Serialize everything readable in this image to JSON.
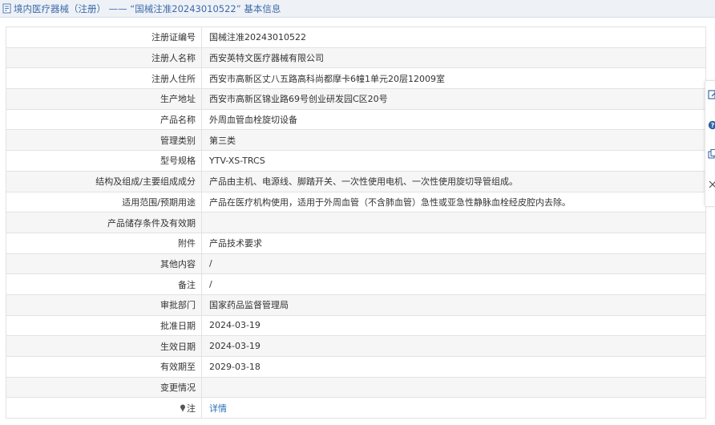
{
  "header": {
    "title": "境内医疗器械（注册） —— “国械注准20243010522” 基本信息",
    "accent_color": "#3d6aa8",
    "icon": "document-icon"
  },
  "rows": [
    {
      "label": "注册证编号",
      "value": "国械注准20243010522"
    },
    {
      "label": "注册人名称",
      "value": "西安英特文医疗器械有限公司"
    },
    {
      "label": "注册人住所",
      "value": "西安市高新区丈八五路高科尚都摩卡6幢1单元20层12009室"
    },
    {
      "label": "生产地址",
      "value": "西安市高新区锦业路69号创业研发园C区20号"
    },
    {
      "label": "产品名称",
      "value": "外周血管血栓旋切设备"
    },
    {
      "label": "管理类别",
      "value": "第三类"
    },
    {
      "label": "型号规格",
      "value": "YTV-XS-TRCS"
    },
    {
      "label": "结构及组成/主要组成成分",
      "value": "产品由主机、电源线、脚踏开关、一次性使用电机、一次性使用旋切导管组成。"
    },
    {
      "label": "适用范围/预期用途",
      "value": "产品在医疗机构使用，适用于外周血管（不含肺血管）急性或亚急性静脉血栓经皮腔内去除。"
    },
    {
      "label": "产品储存条件及有效期",
      "value": ""
    },
    {
      "label": "附件",
      "value": "产品技术要求"
    },
    {
      "label": "其他内容",
      "value": "/"
    },
    {
      "label": "备注",
      "value": "/"
    },
    {
      "label": "审批部门",
      "value": "国家药品监督管理局"
    },
    {
      "label": "批准日期",
      "value": "2024-03-19"
    },
    {
      "label": "生效日期",
      "value": "2024-03-19"
    },
    {
      "label": "有效期至",
      "value": "2029-03-18"
    },
    {
      "label": "变更情况",
      "value": ""
    },
    {
      "label": "注",
      "value": "详情",
      "icon": "pin-icon"
    }
  ],
  "sidebar": {
    "buttons": [
      "edit-icon",
      "help-icon",
      "copy-icon",
      "close-icon"
    ]
  }
}
